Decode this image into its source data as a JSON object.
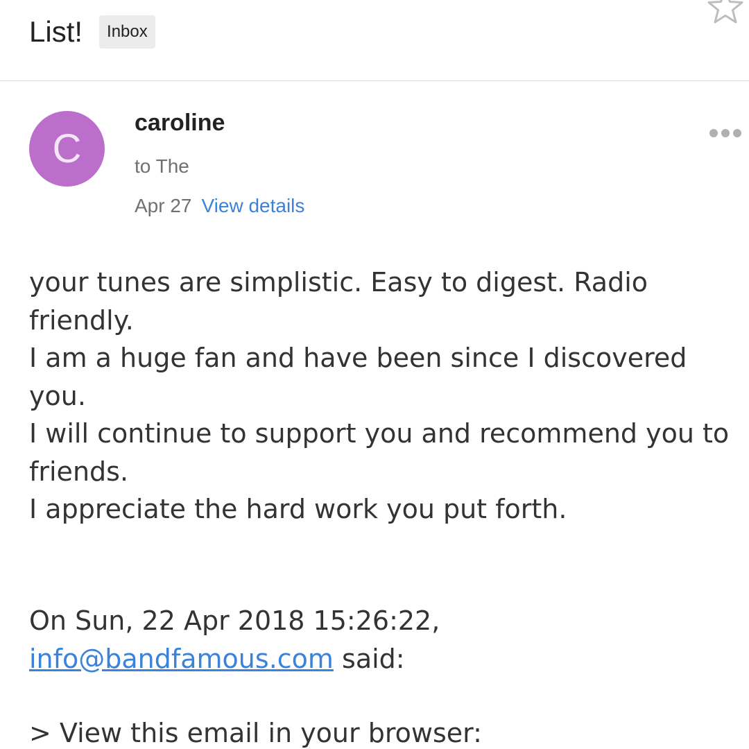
{
  "header": {
    "subject_clipped": "",
    "subject": "List!",
    "label": "Inbox",
    "star_icon": "star-outline-icon"
  },
  "sender": {
    "avatar_letter": "C",
    "avatar_color": "#bb6fcb",
    "name": "caroline",
    "to": "to The",
    "date": "Apr 27",
    "details_link": "View details",
    "more_icon": "more-horizontal-icon"
  },
  "body": {
    "lines": [
      "your tunes are simplistic. Easy to digest. Radio friendly.",
      "I am a huge fan and have been since I discovered you.",
      "I will continue to support you and recommend you to friends.",
      "I appreciate the hard work you put forth."
    ]
  },
  "quote": {
    "header": "On Sun, 22 Apr 2018 15:26:22,",
    "email": "info@bandfamous.com",
    "said": " said:",
    "view_line": "> View this email in your browser:"
  },
  "colors": {
    "link": "#3b82d8",
    "secondary_text": "#707070",
    "badge_bg": "#ececec"
  }
}
